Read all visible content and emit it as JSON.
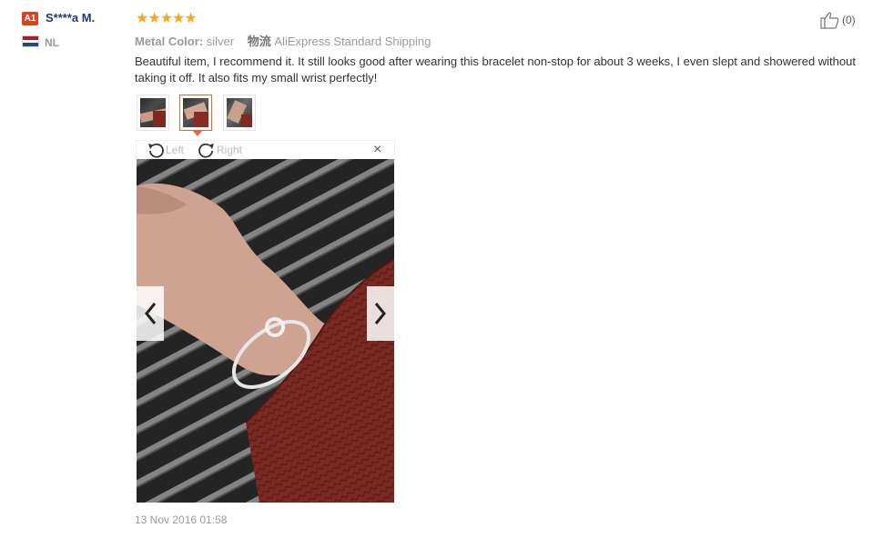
{
  "user": {
    "level_badge": "A1",
    "name": "S****a M.",
    "country": "NL",
    "flag_colors": [
      "#ae1c28",
      "#ffffff",
      "#21468b"
    ]
  },
  "review": {
    "rating": 5,
    "rating_max": 5,
    "star_color": "#f5a623",
    "metal_color_label": "Metal Color:",
    "metal_color_value": "silver",
    "shipping_logo": "物流",
    "shipping_method": "AliExpress Standard Shipping",
    "text": "Beautiful item, I recommend it. It still looks good after wearing this bracelet non-stop for about 3 weeks, I even slept and showered without taking it off. It also fits my small wrist perfectly!",
    "date": "13 Nov 2016 01:58"
  },
  "helpful": {
    "icon": "thumbs-up-icon",
    "count_text": "(0)"
  },
  "thumbnails": {
    "count": 3,
    "active_index": 1
  },
  "viewer": {
    "rotate_left_label": "Left",
    "rotate_right_label": "Right",
    "close_glyph": "×",
    "accent_color": "#e66a2d"
  }
}
